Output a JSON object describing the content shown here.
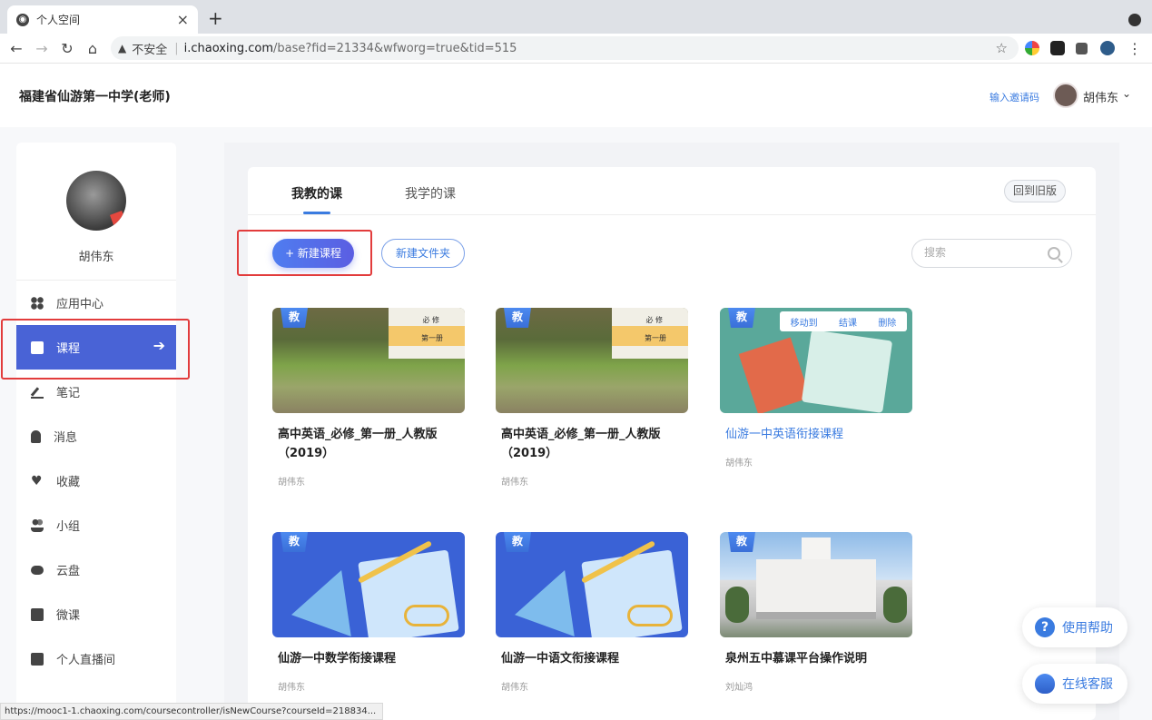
{
  "browser": {
    "tab_title": "个人空间",
    "tab_close": "×",
    "new_tab": "+",
    "insecure_label": "不安全",
    "url_host": "i.chaoxing.com",
    "url_path": "/base?fid=21334&wfworg=true&tid=515",
    "status_url": "https://mooc1-1.chaoxing.com/coursecontroller/isNewCourse?courseId=218834..."
  },
  "header": {
    "school": "福建省仙游第一中学(老师)",
    "invite_code": "输入邀请码",
    "user_name": "胡伟东"
  },
  "sidebar": {
    "user_name": "胡伟东",
    "items": [
      {
        "label": "应用中心",
        "icon": "apps-icon"
      },
      {
        "label": "课程",
        "icon": "course-icon",
        "active": true
      },
      {
        "label": "笔记",
        "icon": "note-icon"
      },
      {
        "label": "消息",
        "icon": "bell-icon"
      },
      {
        "label": "收藏",
        "icon": "heart-icon"
      },
      {
        "label": "小组",
        "icon": "group-icon"
      },
      {
        "label": "云盘",
        "icon": "cloud-icon"
      },
      {
        "label": "微课",
        "icon": "micro-lesson-icon"
      },
      {
        "label": "个人直播间",
        "icon": "live-icon"
      }
    ]
  },
  "main": {
    "tabs": [
      {
        "label": "我教的课",
        "active": true
      },
      {
        "label": "我学的课",
        "active": false
      }
    ],
    "old_version": "回到旧版",
    "new_course": "+ 新建课程",
    "new_folder": "新建文件夹",
    "search_placeholder": "搜索",
    "badge": "教",
    "card_ops": [
      "移动到",
      "结课",
      "删除"
    ],
    "courses": [
      {
        "title": "高中英语_必修_第一册_人教版（2019）",
        "author": "胡伟东",
        "thumb": "ruins-book"
      },
      {
        "title": "高中英语_必修_第一册_人教版（2019）",
        "author": "胡伟东",
        "thumb": "ruins-book"
      },
      {
        "title": "仙游一中英语衔接课程",
        "author": "胡伟东",
        "thumb": "green-books"
      },
      {
        "title": "仙游一中数学衔接课程",
        "author": "胡伟东",
        "thumb": "blue-stationery"
      },
      {
        "title": "仙游一中语文衔接课程",
        "author": "胡伟东",
        "thumb": "blue-stationery"
      },
      {
        "title": "泉州五中慕课平台操作说明",
        "author": "刘灿鸿",
        "thumb": "school-building"
      }
    ],
    "book_text": [
      "必 修",
      "第一册"
    ]
  },
  "floats": {
    "help": "使用帮助",
    "service": "在线客服"
  },
  "colors": {
    "accent": "#3a7be0",
    "sidebar_active": "#4963d6",
    "highlight_box": "#e23c3c"
  }
}
